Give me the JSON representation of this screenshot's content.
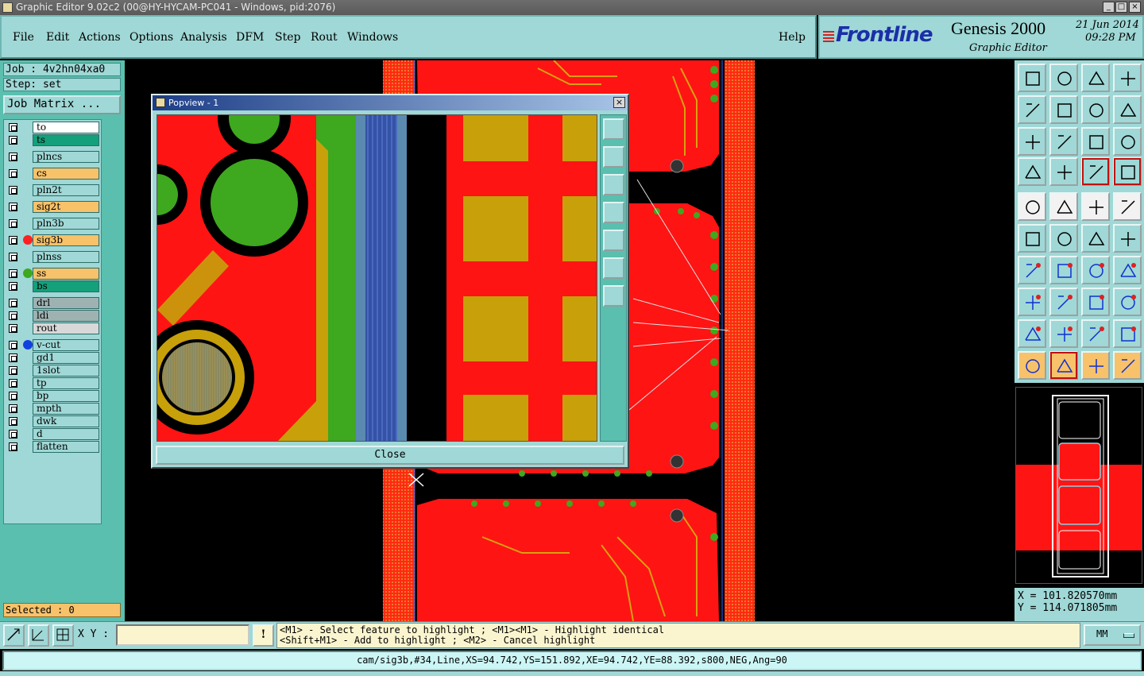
{
  "window": {
    "title": "Graphic Editor 9.02c2 (00@HY-HYCAM-PC041 - Windows, pid:2076)",
    "controls": [
      "_",
      "□",
      "×"
    ]
  },
  "menu": {
    "items": [
      "File",
      "Edit",
      "Actions",
      "Options",
      "Analysis",
      "DFM",
      "Step",
      "Rout",
      "Windows"
    ],
    "help": "Help"
  },
  "brand": {
    "logo": "Frontline",
    "product": "Genesis 2000",
    "subtitle": "Graphic Editor",
    "date": "21 Jun 2014",
    "time": "09:28 PM"
  },
  "left": {
    "job": "Job : 4v2hn04xa0",
    "step": "Step: set",
    "job_matrix": "Job Matrix ...",
    "selected": "Selected : 0",
    "layers": [
      {
        "name": "to",
        "color": "#ffffff",
        "dot": ""
      },
      {
        "name": "ts",
        "color": "#14a07a",
        "dot": ""
      },
      {
        "name": "plncs",
        "color": "#9fd8d6",
        "dot": ""
      },
      {
        "name": "cs",
        "color": "#f7c26a",
        "dot": ""
      },
      {
        "name": "pln2t",
        "color": "#9fd8d6",
        "dot": ""
      },
      {
        "name": "sig2t",
        "color": "#f7c26a",
        "dot": ""
      },
      {
        "name": "pln3b",
        "color": "#9fd8d6",
        "dot": ""
      },
      {
        "name": "sig3b",
        "color": "#f7c26a",
        "dot": "#ff2020"
      },
      {
        "name": "plnss",
        "color": "#9fd8d6",
        "dot": ""
      },
      {
        "name": "ss",
        "color": "#f7c26a",
        "dot": "#3ea81e"
      },
      {
        "name": "bs",
        "color": "#14a07a",
        "dot": ""
      },
      {
        "name": "drl",
        "color": "#9fb2b2",
        "dot": ""
      },
      {
        "name": "ldi",
        "color": "#9fb2b2",
        "dot": ""
      },
      {
        "name": "rout",
        "color": "#d8d8d8",
        "dot": ""
      },
      {
        "name": "v-cut",
        "color": "#9fd8d6",
        "dot": "#1040e0"
      },
      {
        "name": "gd1",
        "color": "#9fd8d6",
        "dot": ""
      },
      {
        "name": "1slot",
        "color": "#9fd8d6",
        "dot": ""
      },
      {
        "name": "tp",
        "color": "#9fd8d6",
        "dot": ""
      },
      {
        "name": "bp",
        "color": "#9fd8d6",
        "dot": ""
      },
      {
        "name": "mpth",
        "color": "#9fd8d6",
        "dot": ""
      },
      {
        "name": "dwk",
        "color": "#9fd8d6",
        "dot": ""
      },
      {
        "name": "d",
        "color": "#9fd8d6",
        "dot": ""
      },
      {
        "name": "flatten",
        "color": "#9fd8d6",
        "dot": ""
      }
    ]
  },
  "popview": {
    "title": "Popview - 1",
    "close_label": "Close",
    "close_x": "×"
  },
  "coords": {
    "x": "X  =  101.820570mm",
    "y": "Y  =  114.071805mm"
  },
  "bottom": {
    "xy_label": "X Y :",
    "xy_value": "",
    "bang": "!",
    "hint1": "<M1> - Select feature to highlight ; <M1><M1> - Highlight identical",
    "hint2": "<Shift+M1> - Add to highlight ; <M2> - Cancel highlight",
    "units": "MM",
    "status": "cam/sig3b,#34,Line,XS=94.742,YS=151.892,XE=94.742,YE=88.392,s800,NEG,Ang=90"
  },
  "icons": {
    "toolbar": [
      "home-view-icon",
      "zoom-in-icon",
      "house-icon",
      "split-view-icon",
      "pan-left-icon",
      "pan-right-icon",
      "flip-icon",
      "mirror-icon",
      "fit-icon",
      "center-icon",
      "scale-1-2-icon",
      "help-query-icon",
      "snap-icon",
      "grid-icon",
      "layers-a-icon",
      "layers-b-icon",
      "add-pad-icon",
      "add-shape-icon",
      "ruler-icon",
      "circle-select-icon",
      "connect-icon",
      "cross-icon",
      "node-icon",
      "node-b-icon",
      "line-icon",
      "line-b-icon",
      "arc-icon",
      "text-icon",
      "pad-icon",
      "bar-icon",
      "measure-icon",
      "net-icon",
      "triangle-a-icon",
      "triangle-b-icon",
      "triangle-c-icon",
      "triangle-d-icon",
      "pointer-icon",
      "select-icon",
      "select-b-icon",
      "route-icon"
    ]
  },
  "colors": {
    "copper": "#ff1414",
    "pad": "#c8a00a",
    "pin": "#3ea81e",
    "panel": "#9fd8d6",
    "highlight": "#f7c26a"
  }
}
